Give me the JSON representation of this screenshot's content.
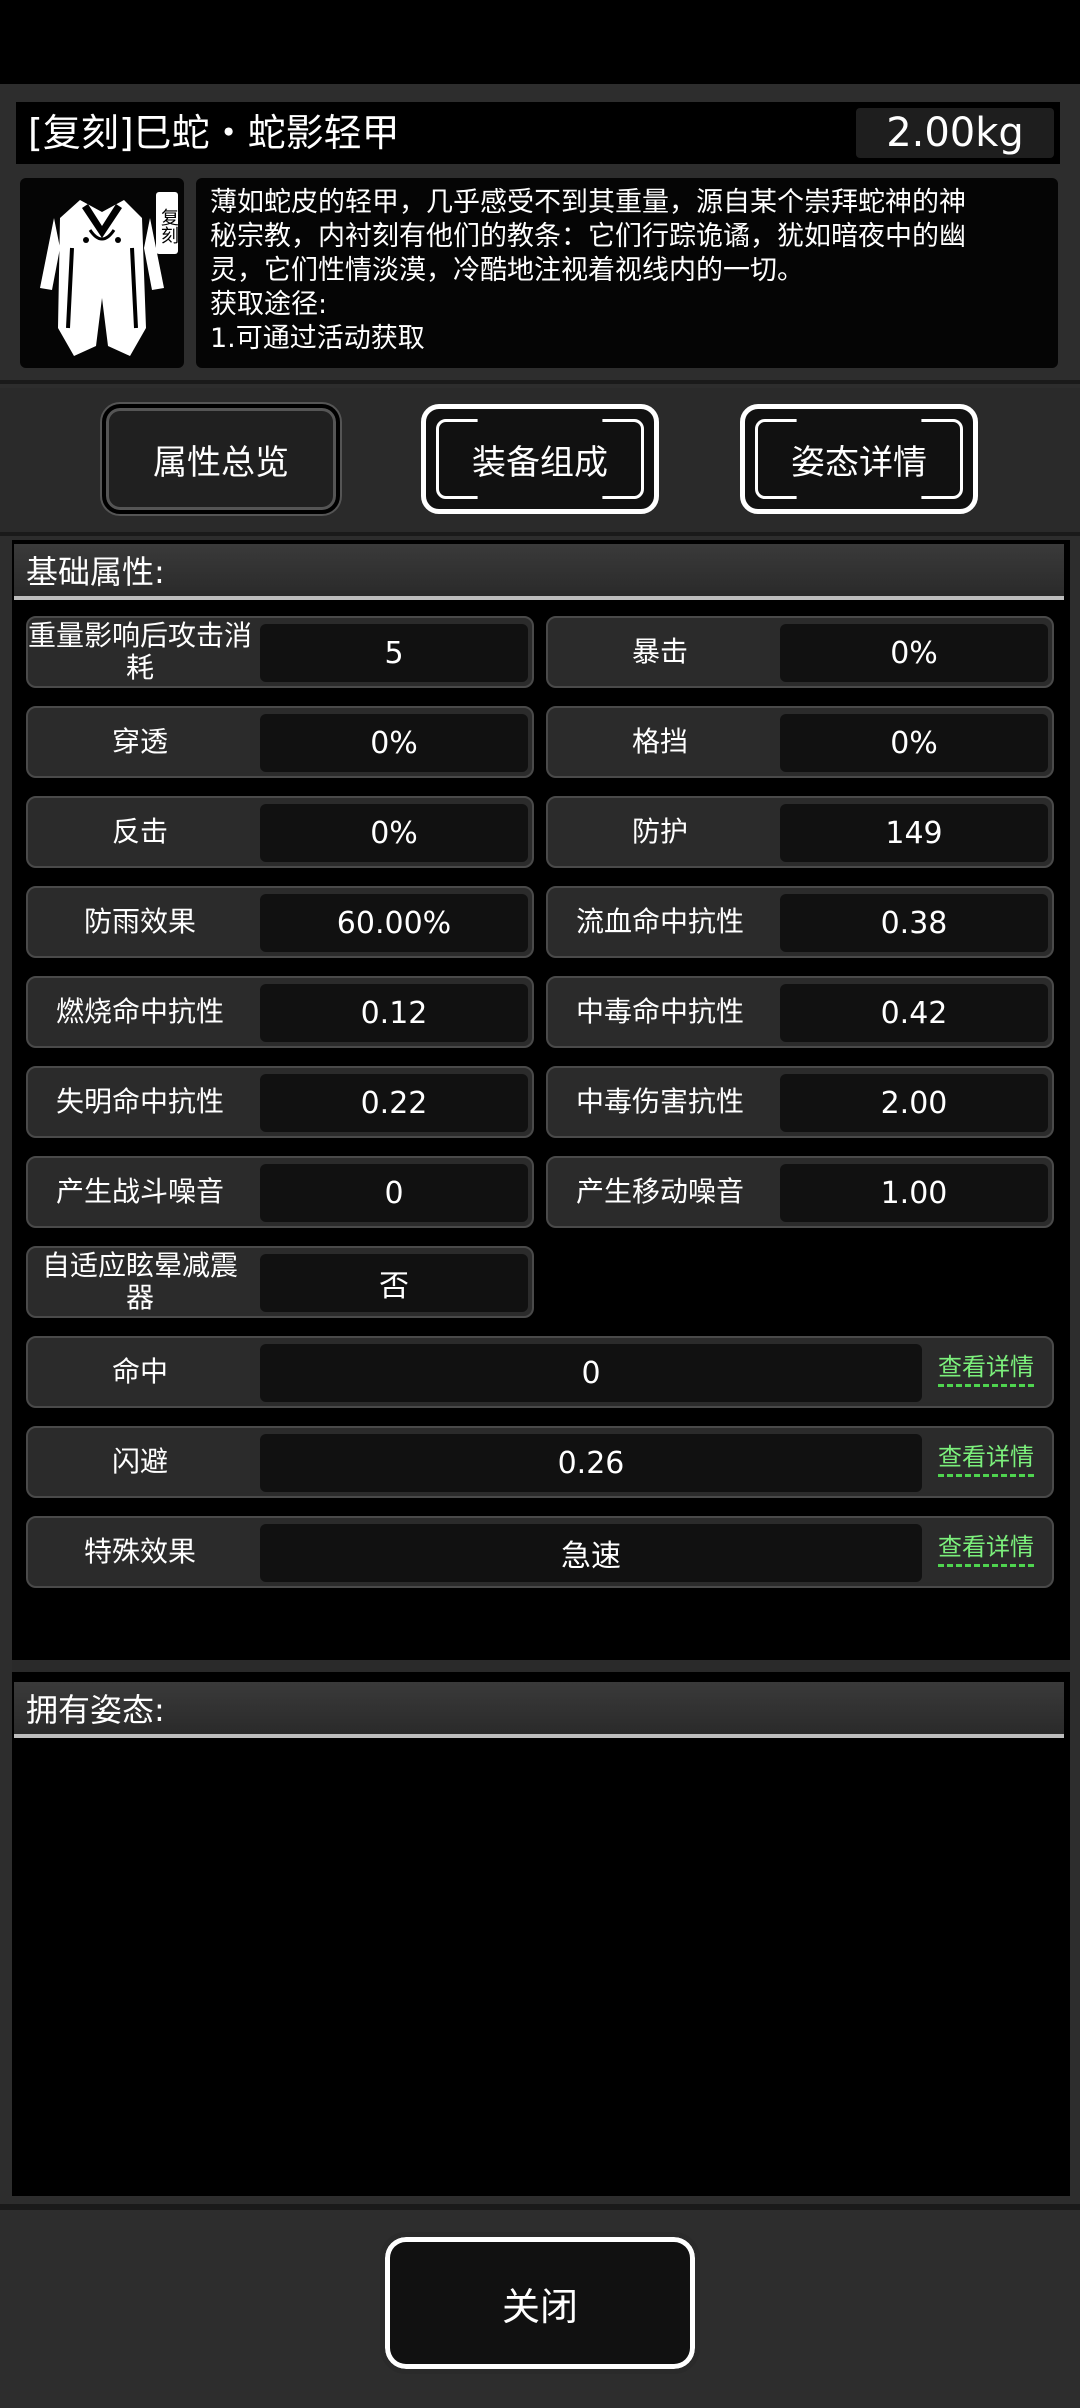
{
  "item": {
    "title": "[复刻]巳蛇・蛇影轻甲",
    "weight": "2.00kg",
    "badge": "复刻",
    "description_lines": [
      "薄如蛇皮的轻甲，几乎感受不到其重量，源自某个崇拜蛇神的神",
      "秘宗教，内衬刻有他们的教条：它们行踪诡谲，犹如暗夜中的幽",
      "灵，它们性情淡漠，冷酷地注视着视线内的一切。",
      "获取途径:",
      "1.可通过活动获取"
    ]
  },
  "tabs": [
    "属性总览",
    "装备组成",
    "姿态详情"
  ],
  "sections": {
    "basic": "基础属性:",
    "stances": "拥有姿态:"
  },
  "stats": [
    {
      "label": "重量影响后攻击消耗",
      "value": "5"
    },
    {
      "label": "暴击",
      "value": "0%"
    },
    {
      "label": "穿透",
      "value": "0%"
    },
    {
      "label": "格挡",
      "value": "0%"
    },
    {
      "label": "反击",
      "value": "0%"
    },
    {
      "label": "防护",
      "value": "149"
    },
    {
      "label": "防雨效果",
      "value": "60.00%"
    },
    {
      "label": "流血命中抗性",
      "value": "0.38"
    },
    {
      "label": "燃烧命中抗性",
      "value": "0.12"
    },
    {
      "label": "中毒命中抗性",
      "value": "0.42"
    },
    {
      "label": "失明命中抗性",
      "value": "0.22"
    },
    {
      "label": "中毒伤害抗性",
      "value": "2.00"
    },
    {
      "label": "产生战斗噪音",
      "value": "0"
    },
    {
      "label": "产生移动噪音",
      "value": "1.00"
    },
    {
      "label": "自适应眩晕减震器",
      "value": "否"
    }
  ],
  "wide_stats": [
    {
      "label": "命中",
      "value": "0",
      "link": "查看详情"
    },
    {
      "label": "闪避",
      "value": "0.26",
      "link": "查看详情"
    },
    {
      "label": "特殊效果",
      "value": "急速",
      "link": "查看详情"
    }
  ],
  "close_label": "关闭",
  "colors": {
    "panel": "#2d2d2d",
    "link_green": "#7cf07c",
    "background": "#000000"
  }
}
